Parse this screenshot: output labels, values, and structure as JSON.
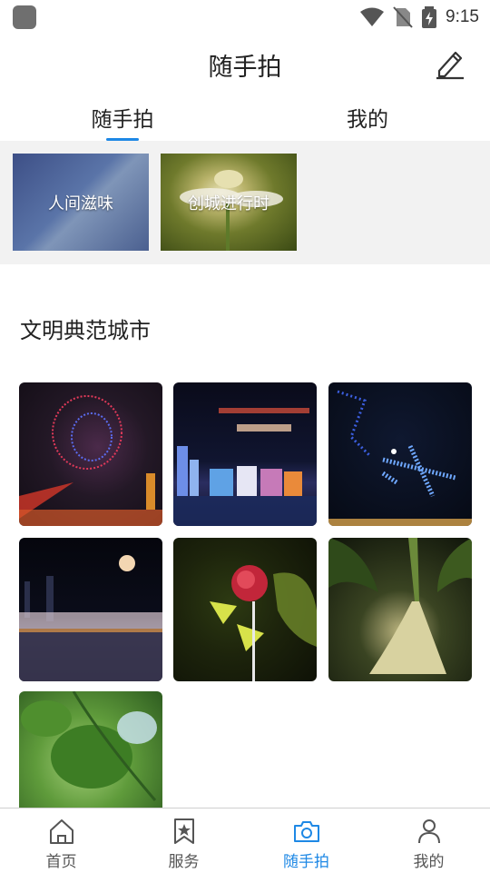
{
  "status_bar": {
    "time": "9:15",
    "icons": [
      "wifi-icon",
      "no-sim-icon",
      "battery-charging-icon"
    ]
  },
  "header": {
    "title": "随手拍",
    "edit_icon": "pencil-icon"
  },
  "tabs": [
    {
      "label": "随手拍",
      "active": true
    },
    {
      "label": "我的",
      "active": false
    }
  ],
  "topics": [
    {
      "label": "人间滋味"
    },
    {
      "label": "创城进行时"
    }
  ],
  "section": {
    "title": "文明典范城市"
  },
  "colors": {
    "accent": "#1e88e5",
    "text": "#222222",
    "topic_bg": "#f2f2f2"
  },
  "bottom_nav": [
    {
      "label": "首页",
      "icon": "home-icon",
      "active": false
    },
    {
      "label": "服务",
      "icon": "bookmark-star-icon",
      "active": false
    },
    {
      "label": "随手拍",
      "icon": "camera-icon",
      "active": true
    },
    {
      "label": "我的",
      "icon": "person-icon",
      "active": false
    }
  ]
}
